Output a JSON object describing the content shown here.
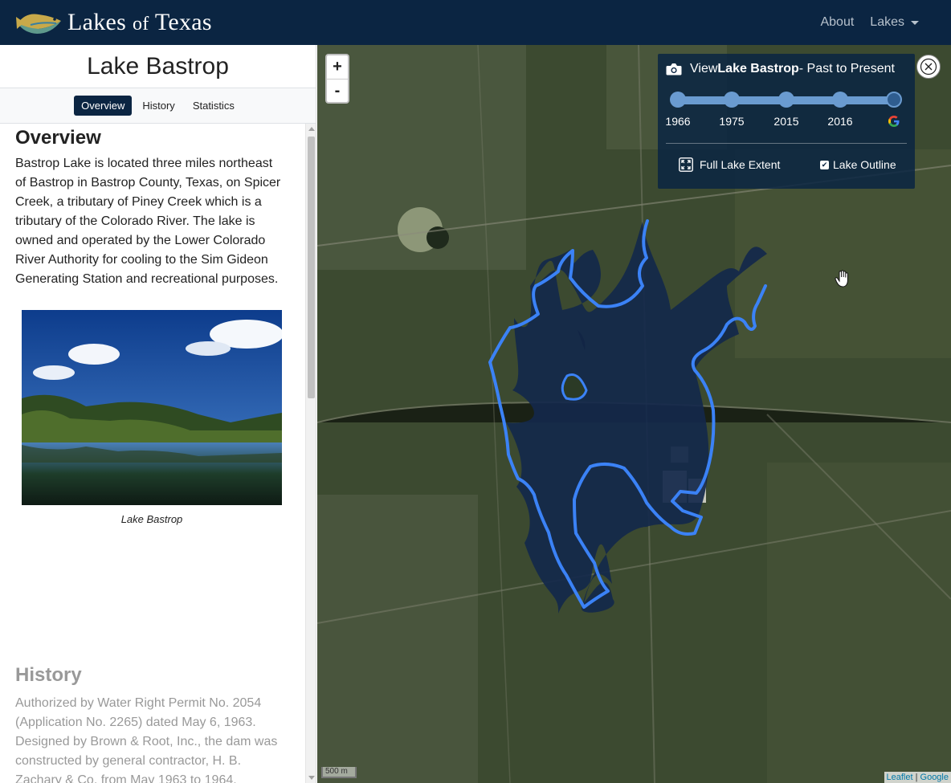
{
  "navbar": {
    "brand_main": "Lakes",
    "brand_of": "of",
    "brand_end": "Texas",
    "links": [
      {
        "label": "About"
      },
      {
        "label": "Lakes"
      }
    ]
  },
  "sidebar": {
    "title": "Lake Bastrop",
    "tabs": [
      {
        "label": "Overview",
        "active": true
      },
      {
        "label": "History",
        "active": false
      },
      {
        "label": "Statistics",
        "active": false
      }
    ],
    "overview": {
      "heading": "Overview",
      "text": "Bastrop Lake is located three miles northeast of Bastrop in Bastrop County, Texas, on Spicer Creek, a tributary of Piney Creek which is a tributary of the Colorado River. The lake is owned and operated by the Lower Colorado River Authority for cooling to the Sim Gideon Generating Station and recreational purposes.",
      "photo_caption": "Lake Bastrop"
    },
    "history": {
      "heading": "History",
      "text": "Authorized by Water Right Permit No. 2054 (Application No. 2265) dated May 6, 1963. Designed by Brown & Root, Inc., the dam was constructed by general contractor, H. B. Zachary & Co. from May 1963 to 1964."
    }
  },
  "map": {
    "zoom_in": "+",
    "zoom_out": "-",
    "panel": {
      "prefix": "View ",
      "lake": "Lake Bastrop",
      "suffix": " - Past to Present",
      "years": [
        "1966",
        "1975",
        "2015",
        "2016"
      ],
      "selected_index": 4,
      "full_extent_label": "Full Lake Extent",
      "outline_label": "Lake Outline",
      "outline_checked": true
    },
    "scale_label": "500 m",
    "attribution": {
      "leaflet": "Leaflet",
      "sep": " | ",
      "google": "Google"
    },
    "colors": {
      "navbar": "#0b2542",
      "lake_outline": "#3b82f6",
      "lake_fill": "#13284b"
    }
  }
}
